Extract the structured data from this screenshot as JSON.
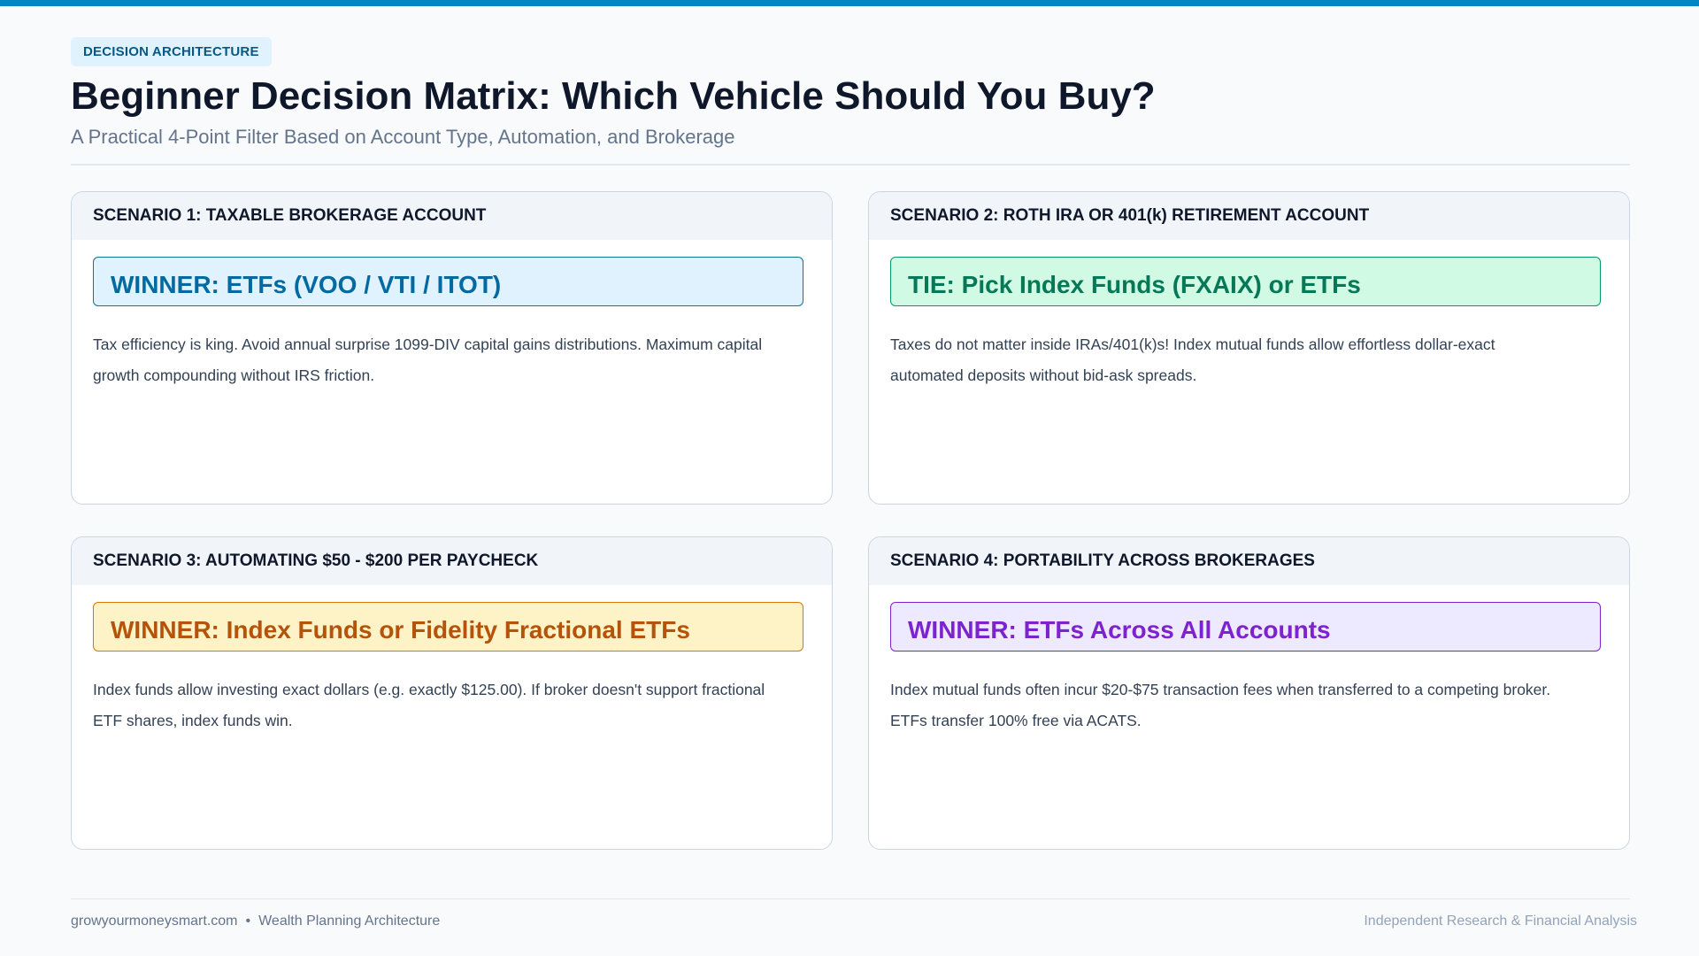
{
  "header": {
    "badge": "DECISION ARCHITECTURE",
    "title": "Beginner Decision Matrix: Which Vehicle Should You Buy?",
    "subtitle": "A Practical 4-Point Filter Based on Account Type, Automation, and Brokerage"
  },
  "scenarios": [
    {
      "heading": "SCENARIO 1: TAXABLE BROKERAGE ACCOUNT",
      "verdict": "WINNER: ETFs (VOO / VTI / ITOT)",
      "body": "Tax efficiency is king. Avoid annual surprise 1099-DIV capital gains distributions. Maximum capital growth compounding without IRS friction.",
      "accent": "#0369a1"
    },
    {
      "heading": "SCENARIO 2: ROTH IRA OR 401(k) RETIREMENT ACCOUNT",
      "verdict": "TIE: Pick Index Funds (FXAIX) or ETFs",
      "body": "Taxes do not matter inside IRAs/401(k)s! Index mutual funds allow effortless dollar-exact automated deposits without bid-ask spreads.",
      "accent": "#047857"
    },
    {
      "heading": "SCENARIO 3: AUTOMATING $50 - $200 PER PAYCHECK",
      "verdict": "WINNER: Index Funds or Fidelity Fractional ETFs",
      "body": "Index funds allow investing exact dollars (e.g. exactly $125.00). If broker doesn't support fractional ETF shares, index funds win.",
      "accent": "#b45309"
    },
    {
      "heading": "SCENARIO 4: PORTABILITY ACROSS BROKERAGES",
      "verdict": "WINNER: ETFs Across All Accounts",
      "body": "Index mutual funds often incur $20-$75 transaction fees when transferred to a competing broker. ETFs transfer 100% free via ACATS.",
      "accent": "#7e22ce"
    }
  ],
  "footer": {
    "site": "growyourmoneysmart.com",
    "separator": "•",
    "section": "Wealth Planning Architecture",
    "tagline": "Independent Research & Financial Analysis"
  }
}
